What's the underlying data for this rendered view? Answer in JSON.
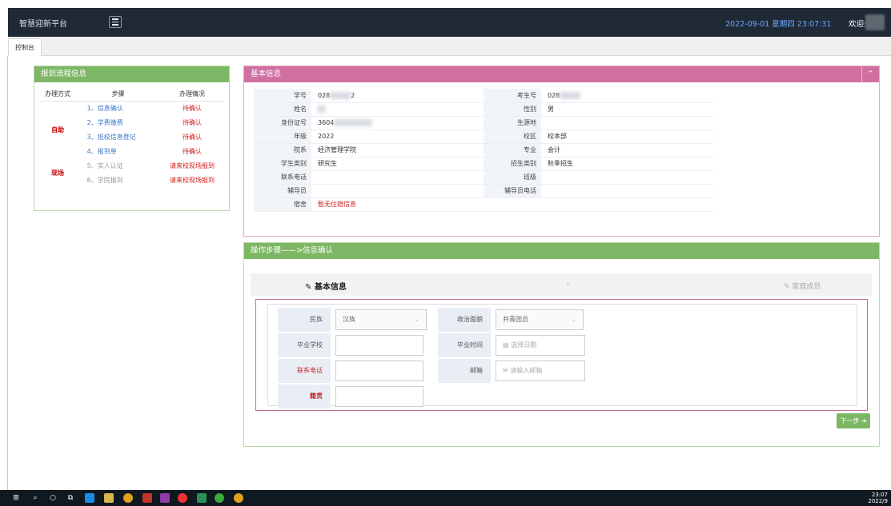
{
  "topbar": {
    "brand": "智慧迎新平台",
    "clock": "2022-09-01 星期四 23:07:31",
    "welcome": "欢迎:"
  },
  "tabs": [
    {
      "label": "控制台"
    }
  ],
  "flow": {
    "title": "报到流程信息",
    "headers": [
      "办理方式",
      "步骤",
      "办理情况"
    ],
    "groups": [
      {
        "mode": "自助"
      },
      {
        "mode": "现场"
      }
    ],
    "rows": [
      {
        "step": "1、信息确认",
        "status": "待确认"
      },
      {
        "step": "2、学费缴费",
        "status": "待确认"
      },
      {
        "step": "3、抵校信息登记",
        "status": "待确认"
      },
      {
        "step": "4、报到单",
        "status": "待确认"
      },
      {
        "step": "5、实人认证",
        "status": "请来校现场报到"
      },
      {
        "step": "6、学院报到",
        "status": "请来校现场报到"
      }
    ]
  },
  "basic": {
    "title": "基本信息",
    "collapse_icon": "chevron-up-icon",
    "rows": [
      {
        "l1": "学号",
        "v1": "028",
        "v1b": "2",
        "l2": "考生号",
        "v2": "028"
      },
      {
        "l1": "姓名",
        "v1": "",
        "l2": "性别",
        "v2": "男"
      },
      {
        "l1": "身份证号",
        "v1": "3604",
        "l2": "生源地",
        "v2": ""
      },
      {
        "l1": "年级",
        "v1": "2022",
        "l2": "校区",
        "v2": "校本部"
      },
      {
        "l1": "院系",
        "v1": "经济管理学院",
        "l2": "专业",
        "v2": "会计"
      },
      {
        "l1": "学生类别",
        "v1": "研究生",
        "l2": "招生类别",
        "v2": "秋季招生"
      },
      {
        "l1": "联系电话",
        "v1": "",
        "l2": "班级",
        "v2": ""
      },
      {
        "l1": "辅导员",
        "v1": "",
        "l2": "辅导员电话",
        "v2": ""
      },
      {
        "l1": "宿舍",
        "v1": "暂无住宿信息"
      }
    ]
  },
  "ops": {
    "title": "操作步骤——>信息确认",
    "step_active": "基本信息",
    "step_next": "家庭成员",
    "form": {
      "nation_label": "民族",
      "nation_value": "汉族",
      "political_label": "政治面貌",
      "political_value": "共青团员",
      "school_label": "毕业学校",
      "school_value": "",
      "grad_time_label": "毕业时间",
      "grad_time_placeholder": "选择日期",
      "phone_label": "联系电话",
      "phone_value": "",
      "email_label": "邮箱",
      "email_placeholder": "请输入邮箱",
      "native_label": "籍贯",
      "native_value": ""
    },
    "next_label": "下一步 ➜"
  },
  "taskbar": {
    "time": "23:07",
    "date": "2022/9"
  }
}
